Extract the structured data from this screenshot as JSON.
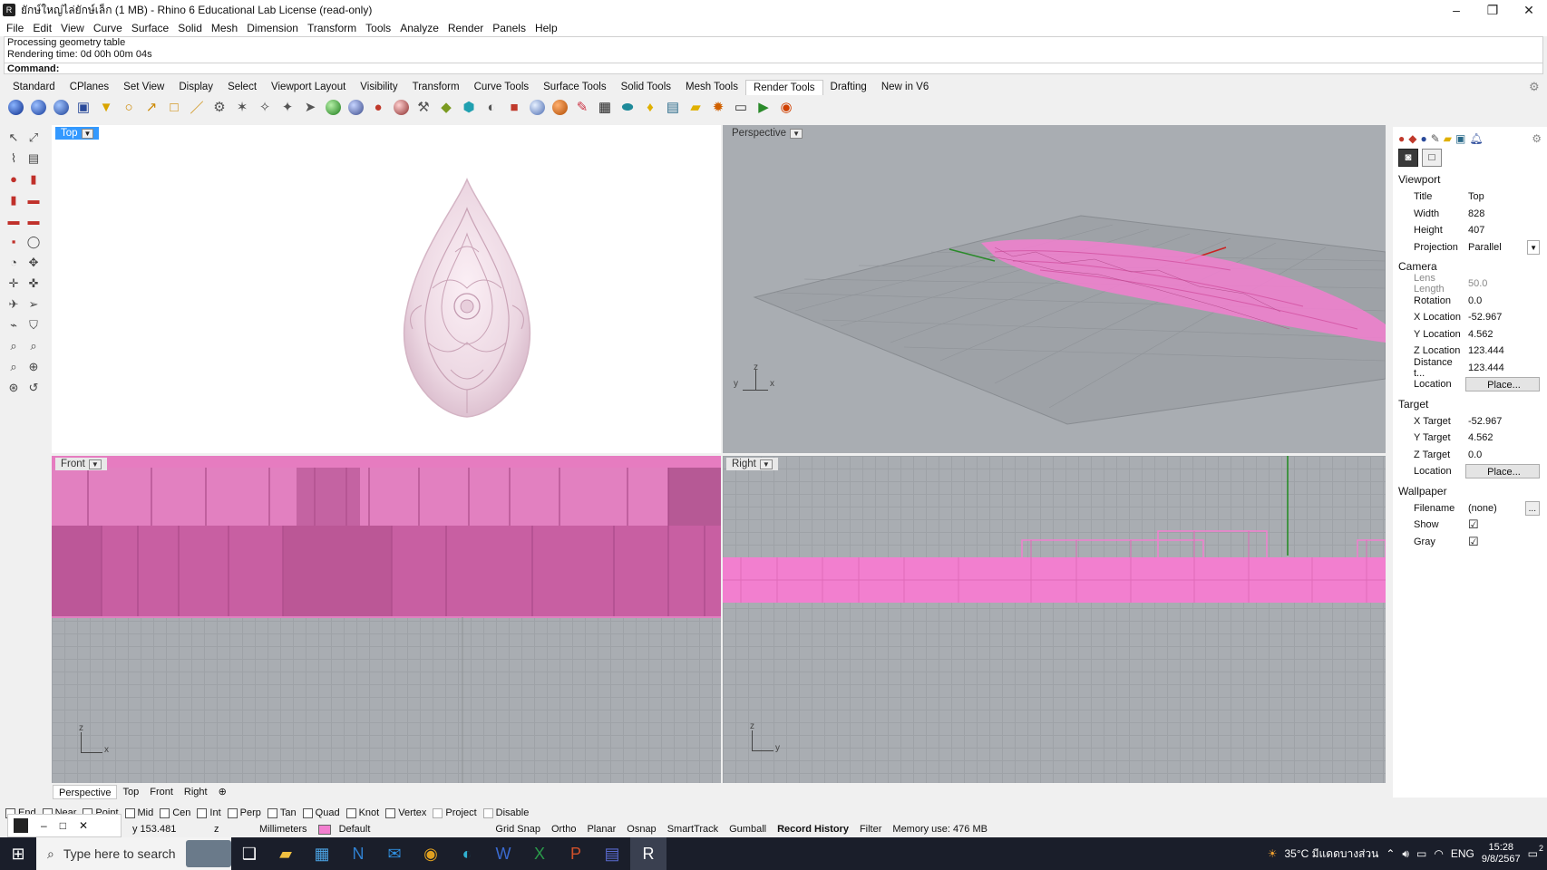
{
  "window": {
    "title": "ยักษ์ใหญ่ไล่ยักษ์เล็ก (1 MB) - Rhino 6 Educational Lab License (read-only)",
    "min": "–",
    "max": "❐",
    "close": "✕"
  },
  "menu": [
    "File",
    "Edit",
    "View",
    "Curve",
    "Surface",
    "Solid",
    "Mesh",
    "Dimension",
    "Transform",
    "Tools",
    "Analyze",
    "Render",
    "Panels",
    "Help"
  ],
  "command": {
    "history": [
      "Processing geometry table",
      "Rendering time: 0d 00h 00m 04s"
    ],
    "prompt": "Command:"
  },
  "tabs": [
    "Standard",
    "CPlanes",
    "Set View",
    "Display",
    "Select",
    "Viewport Layout",
    "Visibility",
    "Transform",
    "Curve Tools",
    "Surface Tools",
    "Solid Tools",
    "Mesh Tools",
    "Render Tools",
    "Drafting",
    "New in V6"
  ],
  "active_tab": "Render Tools",
  "viewports": {
    "top": "Top",
    "perspective": "Perspective",
    "front": "Front",
    "right": "Right"
  },
  "axes": {
    "perspective": [
      "y",
      "z",
      "x"
    ],
    "front": [
      "z",
      "x"
    ],
    "right": [
      "z",
      "y"
    ]
  },
  "viewport_tabs": [
    "Perspective",
    "Top",
    "Front",
    "Right",
    "⊕"
  ],
  "osnaps": [
    {
      "label": "End",
      "on": false
    },
    {
      "label": "Near",
      "on": false
    },
    {
      "label": "Point",
      "on": false
    },
    {
      "label": "Mid",
      "on": false
    },
    {
      "label": "Cen",
      "on": false
    },
    {
      "label": "Int",
      "on": false
    },
    {
      "label": "Perp",
      "on": false
    },
    {
      "label": "Tan",
      "on": false
    },
    {
      "label": "Quad",
      "on": false
    },
    {
      "label": "Knot",
      "on": false
    },
    {
      "label": "Vertex",
      "on": false
    },
    {
      "label": "Project",
      "on": false
    },
    {
      "label": "Disable",
      "on": false
    }
  ],
  "status": {
    "y": "y 153.481",
    "z": "z",
    "units": "Millimeters",
    "layer": "Default",
    "grid_snap": "Grid Snap",
    "ortho": "Ortho",
    "planar": "Planar",
    "osnap": "Osnap",
    "smarttrack": "SmartTrack",
    "gumball": "Gumball",
    "record_history": "Record History",
    "filter": "Filter",
    "memory": "Memory use: 476 MB"
  },
  "panel": {
    "viewport_title": "Viewport",
    "viewport": [
      {
        "k": "Title",
        "v": "Top"
      },
      {
        "k": "Width",
        "v": "828"
      },
      {
        "k": "Height",
        "v": "407"
      },
      {
        "k": "Projection",
        "v": "Parallel"
      }
    ],
    "camera_title": "Camera",
    "camera": [
      {
        "k": "Lens Length",
        "v": "50.0"
      },
      {
        "k": "Rotation",
        "v": "0.0"
      },
      {
        "k": "X Location",
        "v": "-52.967"
      },
      {
        "k": "Y Location",
        "v": "4.562"
      },
      {
        "k": "Z Location",
        "v": "123.444"
      },
      {
        "k": "Distance t...",
        "v": "123.444"
      },
      {
        "k": "Location",
        "v": "Place..."
      }
    ],
    "target_title": "Target",
    "target": [
      {
        "k": "X Target",
        "v": "-52.967"
      },
      {
        "k": "Y Target",
        "v": "4.562"
      },
      {
        "k": "Z Target",
        "v": "0.0"
      },
      {
        "k": "Location",
        "v": "Place..."
      }
    ],
    "wallpaper_title": "Wallpaper",
    "wallpaper": [
      {
        "k": "Filename",
        "v": "(none)"
      },
      {
        "k": "Show",
        "v": "☑"
      },
      {
        "k": "Gray",
        "v": "☑"
      }
    ]
  },
  "taskbar": {
    "search": "Type here to search",
    "weather": "35°C มีแดดบางส่วน",
    "lang": "ENG",
    "time": "15:28",
    "date": "9/8/2567",
    "notif": "2"
  },
  "colors": {
    "pink": "#f27fcf",
    "pink_dark": "#b54a8c",
    "grid": "#a9adb2",
    "accent": "#3399ff"
  }
}
